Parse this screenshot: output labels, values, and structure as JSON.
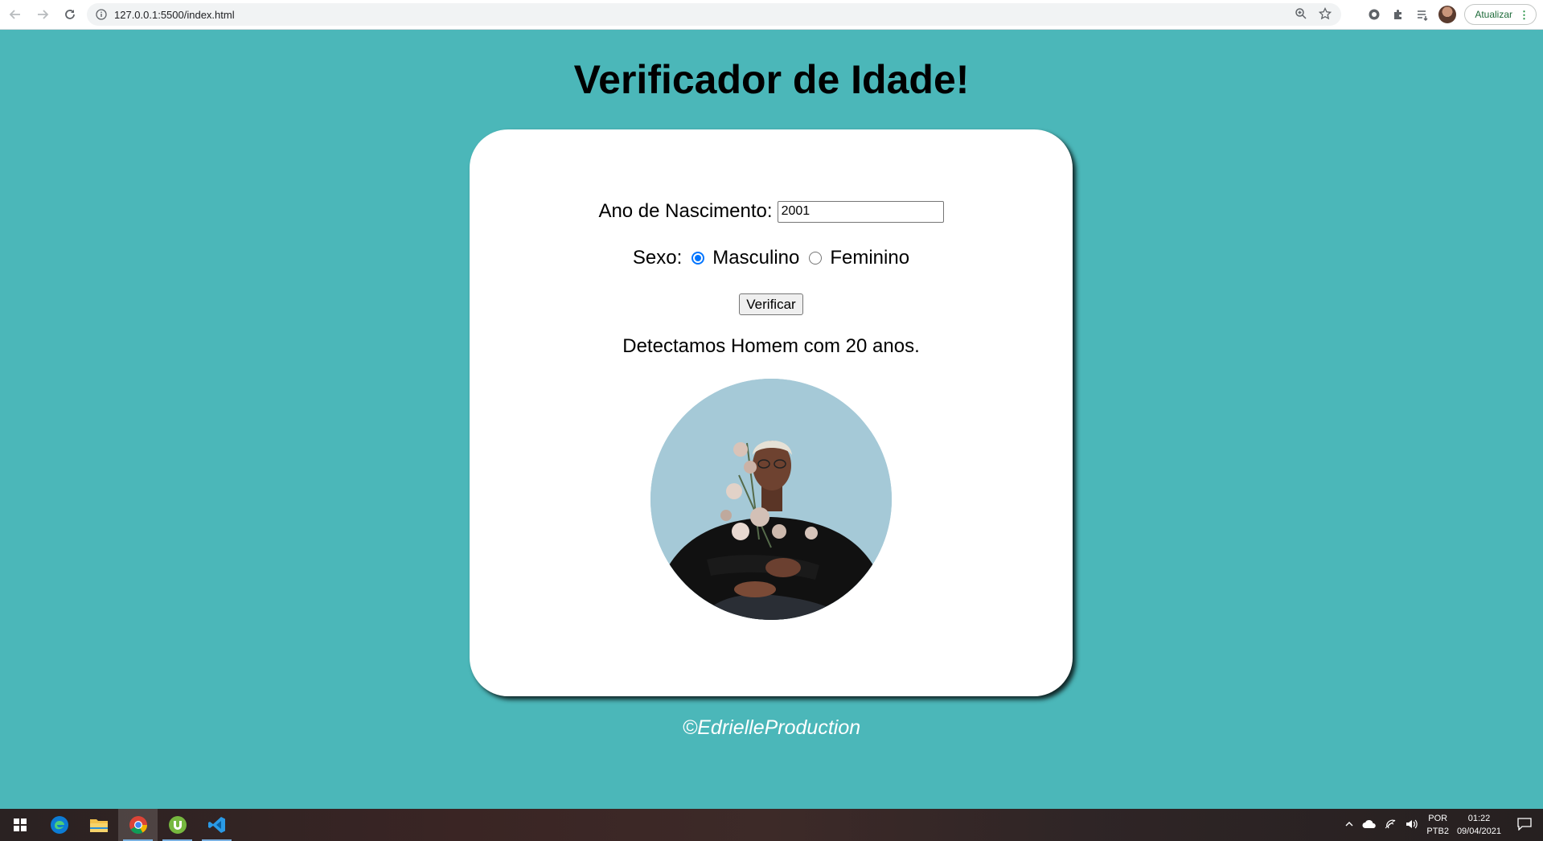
{
  "browser": {
    "url": "127.0.0.1:5500/index.html",
    "update_label": "Atualizar"
  },
  "page": {
    "title": "Verificador de Idade!",
    "year_label": "Ano de Nascimento:",
    "year_value": "2001",
    "sex_label": "Sexo:",
    "sex_options": [
      "Masculino",
      "Feminino"
    ],
    "sex_selected": "Masculino",
    "verify_label": "Verificar",
    "result_text": "Detectamos Homem com 20 anos.",
    "footer": "©EdrielleProduction"
  },
  "taskbar": {
    "apps": [
      "windows-start",
      "edge",
      "file-explorer",
      "chrome",
      "utorrent",
      "vscode"
    ],
    "lang_top": "POR",
    "lang_bottom": "PTB2",
    "time": "01:22",
    "date": "09/04/2021"
  },
  "colors": {
    "page_bg": "#4bb7b9",
    "card_bg": "#ffffff",
    "radio_accent": "#0075ff"
  }
}
